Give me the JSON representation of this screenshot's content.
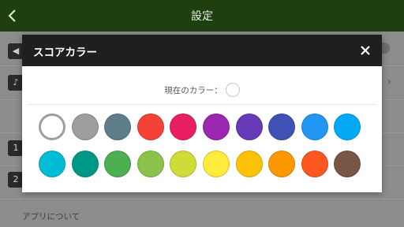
{
  "header": {
    "title": "設定"
  },
  "underlying": {
    "items": [
      {
        "icon": "speaker-icon"
      },
      {
        "icon": "music-note-icon"
      },
      {
        "badge": "1"
      },
      {
        "badge": "2"
      }
    ],
    "about_label": "アプリについて"
  },
  "dialog": {
    "title": "スコアカラー",
    "current_label": "現在のカラー：",
    "current_color": "#ffffff",
    "colors_row1": [
      "#ffffff",
      "#9e9e9e",
      "#607d8b",
      "#f44336",
      "#e91e63",
      "#9c27b0",
      "#673ab7",
      "#3f51b5",
      "#2196f3",
      "#03a9f4"
    ],
    "colors_row2": [
      "#00bcd4",
      "#009688",
      "#4caf50",
      "#8bc34a",
      "#cddc39",
      "#ffeb3b",
      "#ffc107",
      "#ff9800",
      "#ff5722",
      "#795548"
    ]
  }
}
